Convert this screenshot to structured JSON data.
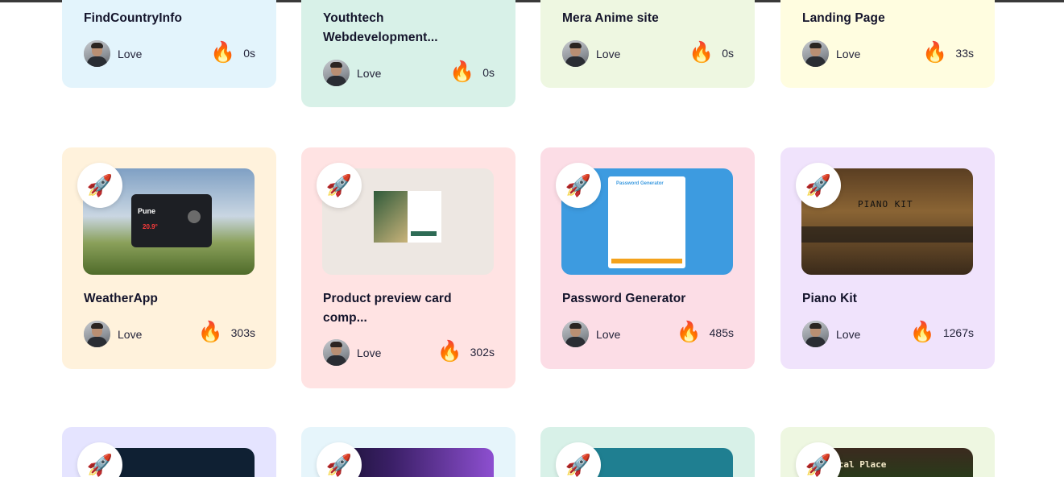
{
  "colors": {
    "blue_light": "#e3f4fc",
    "mint": "#d8f1e8",
    "sage": "#eef7e1",
    "cream": "#fffde0",
    "peach": "#fff2dc",
    "pink_light": "#ffe3e3",
    "pink": "#fcdde6",
    "lavender": "#f0e3fc",
    "periwinkle": "#e5e4ff",
    "sky": "#e6f5fb"
  },
  "cards": [
    {
      "title": "FindCountryInfo",
      "author": "Love",
      "likes": "0s"
    },
    {
      "title": "Youthtech Webdevelopment...",
      "author": "Love",
      "likes": "0s"
    },
    {
      "title": "Mera Anime site",
      "author": "Love",
      "likes": "0s"
    },
    {
      "title": "Landing Page",
      "author": "Love",
      "likes": "33s"
    },
    {
      "title": "WeatherApp",
      "author": "Love",
      "likes": "303s",
      "thumb": "weather"
    },
    {
      "title": "Product preview card comp...",
      "author": "Love",
      "likes": "302s",
      "thumb": "product"
    },
    {
      "title": "Password Generator",
      "author": "Love",
      "likes": "485s",
      "thumb": "password"
    },
    {
      "title": "Piano Kit",
      "author": "Love",
      "likes": "1267s",
      "thumb": "piano"
    }
  ],
  "thumbnails": {
    "weather_city": "Pune",
    "weather_temp": "20.9°",
    "password_header": "Password Generator",
    "piano_label": "PIANO KIT",
    "mystic_label": "-Mystical Place"
  },
  "badge_icon": "rocket-icon",
  "likes_icon": "fire-icon"
}
